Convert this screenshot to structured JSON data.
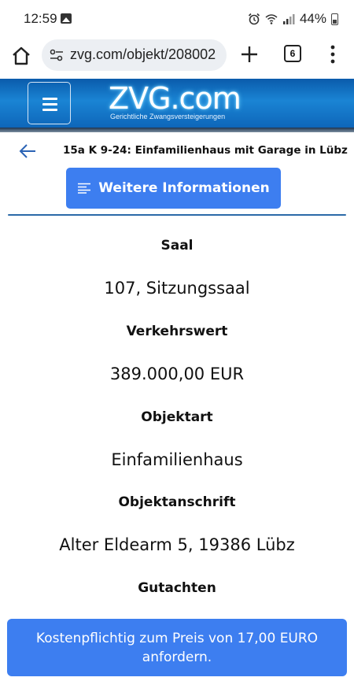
{
  "status_bar": {
    "time": "12:59",
    "battery": "44%"
  },
  "browser": {
    "url": "zvg.com/objekt/208002",
    "tab_count": "6"
  },
  "site": {
    "logo_text": "ZVG.com",
    "logo_tagline": "Gerichtliche Zwangsversteigerungen"
  },
  "page": {
    "title": "15a K 9-24: Einfamilienhaus mit Garage in Lübz",
    "info_button": "Weitere Informationen"
  },
  "details": [
    {
      "label": "Saal",
      "value": "107, Sitzungssaal"
    },
    {
      "label": "Verkehrswert",
      "value": "389.000,00 EUR"
    },
    {
      "label": "Objektart",
      "value": "Einfamilienhaus"
    },
    {
      "label": "Objektanschrift",
      "value": "Alter Eldearm 5, 19386 Lübz"
    },
    {
      "label": "Gutachten",
      "value": ""
    }
  ],
  "cta": {
    "line1": "Kostenpflichtig zum Preis von 17,00 EURO",
    "line2": "anfordern."
  },
  "colors": {
    "primary_button": "#3d7ef0",
    "header_blue": "#0e66b9",
    "divider": "#2b6aa8"
  }
}
